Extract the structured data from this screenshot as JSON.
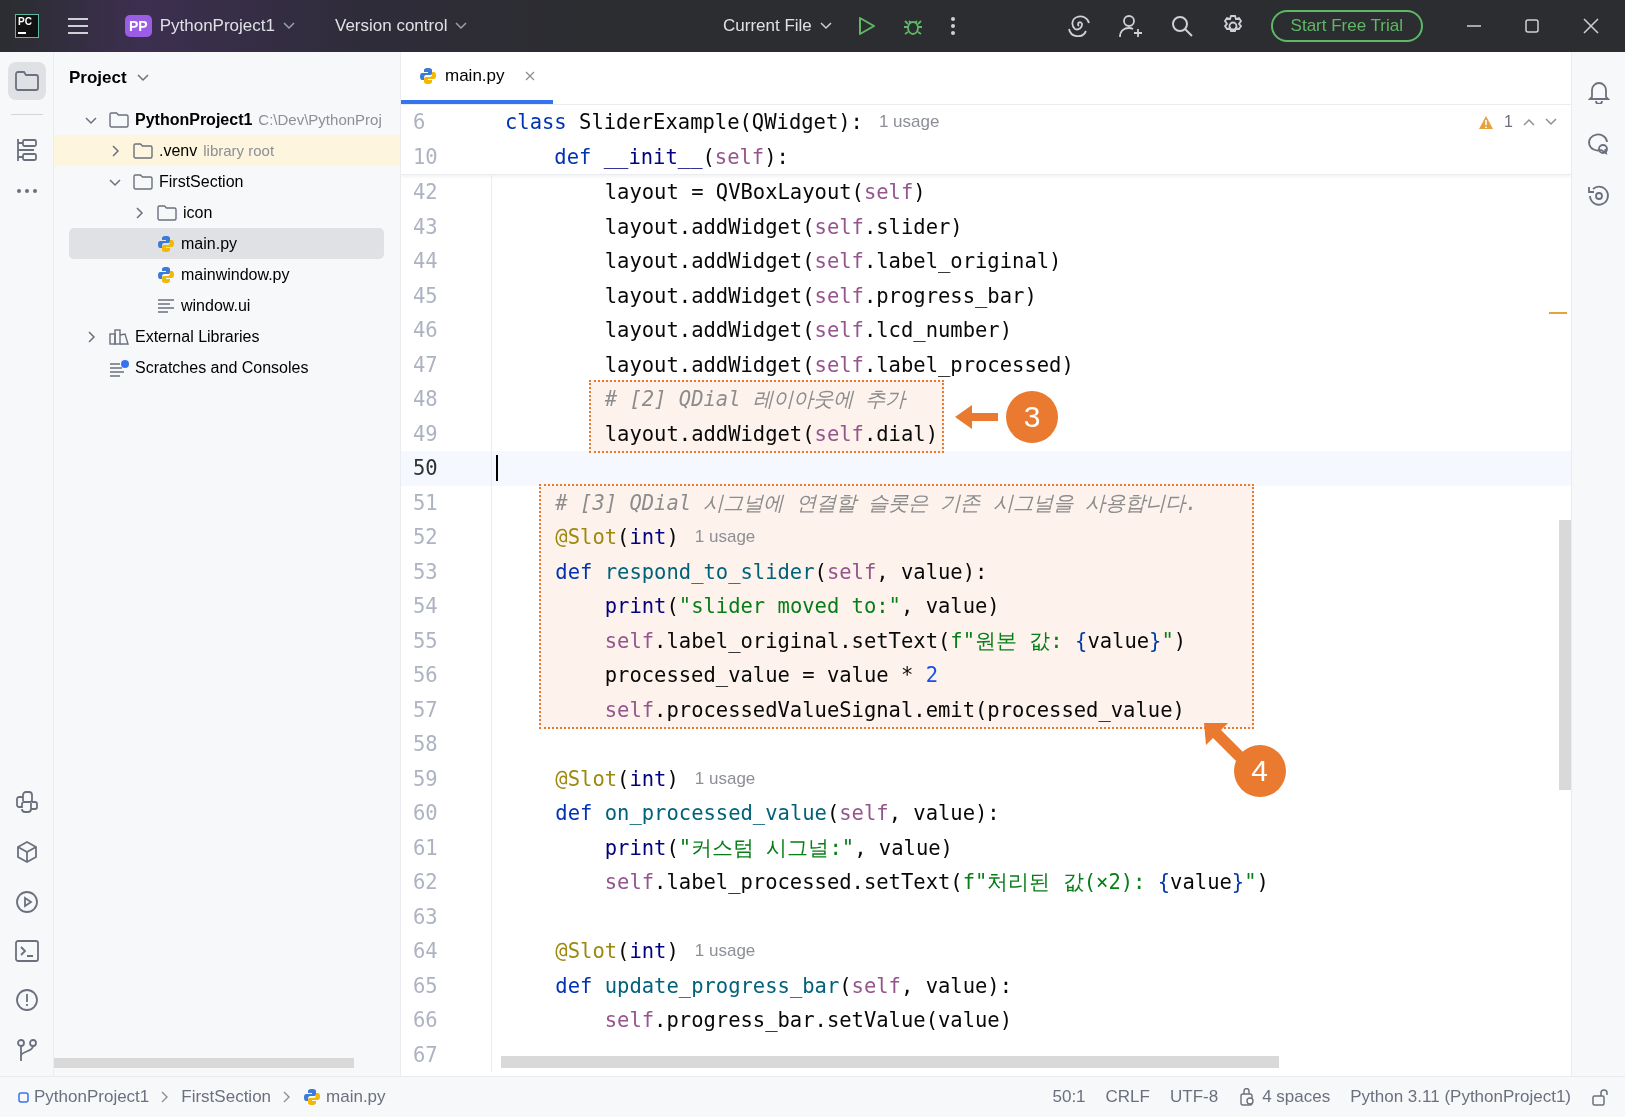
{
  "titlebar": {
    "logo_text": "PC",
    "project": {
      "badge": "PP",
      "name": "PythonProject1"
    },
    "vcs": "Version control",
    "run_config": "Current File",
    "trial_button": "Start Free Trial"
  },
  "project": {
    "title": "Project",
    "tree": [
      {
        "label": "PythonProject1",
        "hint": "C:\\Dev\\PythonProj",
        "kind": "project-root",
        "expanded": true,
        "selected": false,
        "highlighted": false,
        "children": [
          {
            "label": ".venv",
            "hint": "library root",
            "kind": "folder",
            "expanded": false,
            "selected": false,
            "highlighted": true
          },
          {
            "label": "FirstSection",
            "kind": "folder",
            "expanded": true,
            "selected": false,
            "highlighted": false,
            "children": [
              {
                "label": "icon",
                "kind": "folder",
                "expanded": false,
                "selected": false,
                "highlighted": false
              },
              {
                "label": "main.py",
                "kind": "python",
                "selected": true,
                "highlighted": false
              },
              {
                "label": "mainwindow.py",
                "kind": "python",
                "selected": false,
                "highlighted": false
              },
              {
                "label": "window.ui",
                "kind": "text",
                "selected": false,
                "highlighted": false
              }
            ]
          }
        ]
      },
      {
        "label": "External Libraries",
        "kind": "library",
        "expanded": false,
        "selected": false,
        "highlighted": false
      },
      {
        "label": "Scratches and Consoles",
        "kind": "scratch",
        "selected": false,
        "highlighted": false
      }
    ]
  },
  "editor": {
    "tabs": [
      {
        "label": "main.py",
        "selected": true
      }
    ],
    "inspection": {
      "count": "1"
    },
    "sticky": [
      {
        "number": "6",
        "tokens": [
          {
            "kind": "kw",
            "text": "class"
          },
          {
            "kind": "plain",
            "text": " SliderExample(QWidget):"
          }
        ],
        "hint": "1 usage"
      },
      {
        "number": "10",
        "tokens": [
          {
            "kind": "kw",
            "text": "    def"
          },
          {
            "kind": "builtin",
            "text": " __init__"
          },
          {
            "kind": "plain",
            "text": "("
          },
          {
            "kind": "self",
            "text": "self"
          },
          {
            "kind": "plain",
            "text": "):"
          }
        ]
      }
    ],
    "blocks": [
      {
        "kind": "plain",
        "lines": [
          {
            "number": "42",
            "tokens": [
              {
                "kind": "plain",
                "text": "        layout = QVBoxLayout("
              },
              {
                "kind": "self",
                "text": "self"
              },
              {
                "kind": "plain",
                "text": ")"
              }
            ]
          },
          {
            "number": "43",
            "tokens": [
              {
                "kind": "plain",
                "text": "        layout.addWidget("
              },
              {
                "kind": "self",
                "text": "self"
              },
              {
                "kind": "plain",
                "text": ".slider)"
              }
            ]
          },
          {
            "number": "44",
            "tokens": [
              {
                "kind": "plain",
                "text": "        layout.addWidget("
              },
              {
                "kind": "self",
                "text": "self"
              },
              {
                "kind": "plain",
                "text": ".label_original)"
              }
            ]
          },
          {
            "number": "45",
            "tokens": [
              {
                "kind": "plain",
                "text": "        layout.addWidget("
              },
              {
                "kind": "self",
                "text": "self"
              },
              {
                "kind": "plain",
                "text": ".progress_bar)"
              }
            ]
          },
          {
            "number": "46",
            "tokens": [
              {
                "kind": "plain",
                "text": "        layout.addWidget("
              },
              {
                "kind": "self",
                "text": "self"
              },
              {
                "kind": "plain",
                "text": ".lcd_number)"
              }
            ]
          },
          {
            "number": "47",
            "tokens": [
              {
                "kind": "plain",
                "text": "        layout.addWidget("
              },
              {
                "kind": "self",
                "text": "self"
              },
              {
                "kind": "plain",
                "text": ".label_processed)"
              }
            ]
          }
        ]
      },
      {
        "kind": "callout-left",
        "label": "3",
        "lines": [
          {
            "number": "48",
            "tokens": [
              {
                "kind": "cmt",
                "text": "# [2] QDial 레이아웃에 추가"
              }
            ]
          },
          {
            "number": "49",
            "tokens": [
              {
                "kind": "plain",
                "text": "layout.addWidget("
              },
              {
                "kind": "self",
                "text": "self"
              },
              {
                "kind": "plain",
                "text": ".dial)"
              }
            ]
          }
        ]
      },
      {
        "kind": "plain",
        "lines": [
          {
            "number": "50",
            "current": true
          }
        ]
      },
      {
        "kind": "callout-up-left",
        "label": "4",
        "lines": [
          {
            "number": "51",
            "tokens": [
              {
                "kind": "cmt",
                "text": "# [3] QDial 시그널에 연결할 슬롯은 기존 시그널을 사용합니다."
              }
            ]
          },
          {
            "number": "52",
            "tokens": [
              {
                "kind": "deco",
                "text": "@Slot"
              },
              {
                "kind": "plain",
                "text": "("
              },
              {
                "kind": "builtin",
                "text": "int"
              },
              {
                "kind": "plain",
                "text": ")"
              }
            ],
            "hint": "1 usage"
          },
          {
            "number": "53",
            "tokens": [
              {
                "kind": "kw",
                "text": "def"
              },
              {
                "kind": "fn",
                "text": " respond_to_slider"
              },
              {
                "kind": "plain",
                "text": "("
              },
              {
                "kind": "self",
                "text": "self"
              },
              {
                "kind": "plain",
                "text": ", value):"
              }
            ]
          },
          {
            "number": "54",
            "tokens": [
              {
                "kind": "builtin",
                "text": "    print"
              },
              {
                "kind": "plain",
                "text": "("
              },
              {
                "kind": "str",
                "text": "\"slider moved to:\""
              },
              {
                "kind": "plain",
                "text": ", value)"
              }
            ]
          },
          {
            "number": "55",
            "tokens": [
              {
                "kind": "self",
                "text": "    self"
              },
              {
                "kind": "plain",
                "text": ".label_original.setText("
              },
              {
                "kind": "str",
                "text": "f\"원본 값: "
              },
              {
                "kind": "brace",
                "text": "{"
              },
              {
                "kind": "plain",
                "text": "value"
              },
              {
                "kind": "brace",
                "text": "}"
              },
              {
                "kind": "str",
                "text": "\""
              },
              {
                "kind": "plain",
                "text": ")"
              }
            ]
          },
          {
            "number": "56",
            "tokens": [
              {
                "kind": "plain",
                "text": "    processed_value = value * "
              },
              {
                "kind": "num",
                "text": "2"
              }
            ]
          },
          {
            "number": "57",
            "tokens": [
              {
                "kind": "self",
                "text": "    self"
              },
              {
                "kind": "plain",
                "text": ".processedValueSignal.emit(processed_value)"
              }
            ]
          }
        ]
      },
      {
        "kind": "plain",
        "lines": [
          {
            "number": "58"
          },
          {
            "number": "59",
            "tokens": [
              {
                "kind": "deco",
                "text": "    @Slot"
              },
              {
                "kind": "plain",
                "text": "("
              },
              {
                "kind": "builtin",
                "text": "int"
              },
              {
                "kind": "plain",
                "text": ")"
              }
            ],
            "hint": "1 usage"
          },
          {
            "number": "60",
            "tokens": [
              {
                "kind": "kw",
                "text": "    def"
              },
              {
                "kind": "fn",
                "text": " on_processed_value"
              },
              {
                "kind": "plain",
                "text": "("
              },
              {
                "kind": "self",
                "text": "self"
              },
              {
                "kind": "plain",
                "text": ", value):"
              }
            ]
          },
          {
            "number": "61",
            "tokens": [
              {
                "kind": "builtin",
                "text": "        print"
              },
              {
                "kind": "plain",
                "text": "("
              },
              {
                "kind": "str",
                "text": "\"커스텀 시그널:\""
              },
              {
                "kind": "plain",
                "text": ", value)"
              }
            ]
          },
          {
            "number": "62",
            "tokens": [
              {
                "kind": "self",
                "text": "        self"
              },
              {
                "kind": "plain",
                "text": ".label_processed.setText("
              },
              {
                "kind": "str",
                "text": "f\"처리된 값(×2): "
              },
              {
                "kind": "brace",
                "text": "{"
              },
              {
                "kind": "plain",
                "text": "value"
              },
              {
                "kind": "brace",
                "text": "}"
              },
              {
                "kind": "str",
                "text": "\""
              },
              {
                "kind": "plain",
                "text": ")"
              }
            ]
          },
          {
            "number": "63"
          },
          {
            "number": "64",
            "tokens": [
              {
                "kind": "deco",
                "text": "    @Slot"
              },
              {
                "kind": "plain",
                "text": "("
              },
              {
                "kind": "builtin",
                "text": "int"
              },
              {
                "kind": "plain",
                "text": ")"
              }
            ],
            "hint": "1 usage"
          },
          {
            "number": "65",
            "tokens": [
              {
                "kind": "kw",
                "text": "    def"
              },
              {
                "kind": "fn",
                "text": " update_progress_bar"
              },
              {
                "kind": "plain",
                "text": "("
              },
              {
                "kind": "self",
                "text": "self"
              },
              {
                "kind": "plain",
                "text": ", value):"
              }
            ]
          },
          {
            "number": "66",
            "tokens": [
              {
                "kind": "self",
                "text": "        self"
              },
              {
                "kind": "plain",
                "text": ".progress_bar.setValue(value)"
              }
            ]
          },
          {
            "number": "67"
          }
        ]
      }
    ]
  },
  "status_bar": {
    "breadcrumbs": [
      {
        "label": "PythonProject1",
        "kind": "module"
      },
      {
        "label": "FirstSection"
      },
      {
        "label": "main.py",
        "kind": "python"
      }
    ],
    "items": [
      {
        "label": "50:1"
      },
      {
        "label": "CRLF"
      },
      {
        "label": "UTF-8"
      },
      {
        "label": "4 spaces",
        "kind": "indent"
      },
      {
        "label": "Python 3.11 (PythonProject1)"
      }
    ]
  }
}
